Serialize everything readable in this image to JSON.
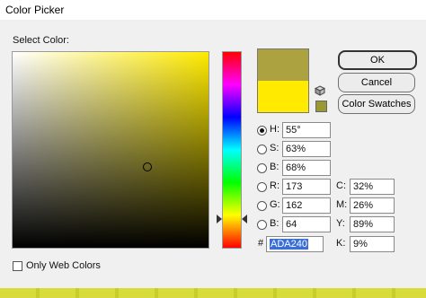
{
  "window": {
    "title": "Color Picker"
  },
  "section_label": "Select Color:",
  "colors": {
    "new": "#ADA240",
    "current": "#FFEA00",
    "web_safe": "#999933"
  },
  "buttons": {
    "ok": "OK",
    "cancel": "Cancel",
    "swatches": "Color Swatches"
  },
  "hsb": [
    {
      "label": "H:",
      "value": "55°",
      "checked": true
    },
    {
      "label": "S:",
      "value": "63%",
      "checked": false
    },
    {
      "label": "B:",
      "value": "68%",
      "checked": false
    }
  ],
  "rgb": [
    {
      "label": "R:",
      "value": "173",
      "checked": false
    },
    {
      "label": "G:",
      "value": "162",
      "checked": false
    },
    {
      "label": "B:",
      "value": "64",
      "checked": false
    }
  ],
  "hex": {
    "label": "#",
    "value": "ADA240"
  },
  "cmyk": [
    {
      "label": "C:",
      "value": "32%"
    },
    {
      "label": "M:",
      "value": "26%"
    },
    {
      "label": "Y:",
      "value": "89%"
    },
    {
      "label": "K:",
      "value": "9%"
    }
  ],
  "only_web_colors": {
    "label": "Only Web Colors",
    "checked": false
  }
}
